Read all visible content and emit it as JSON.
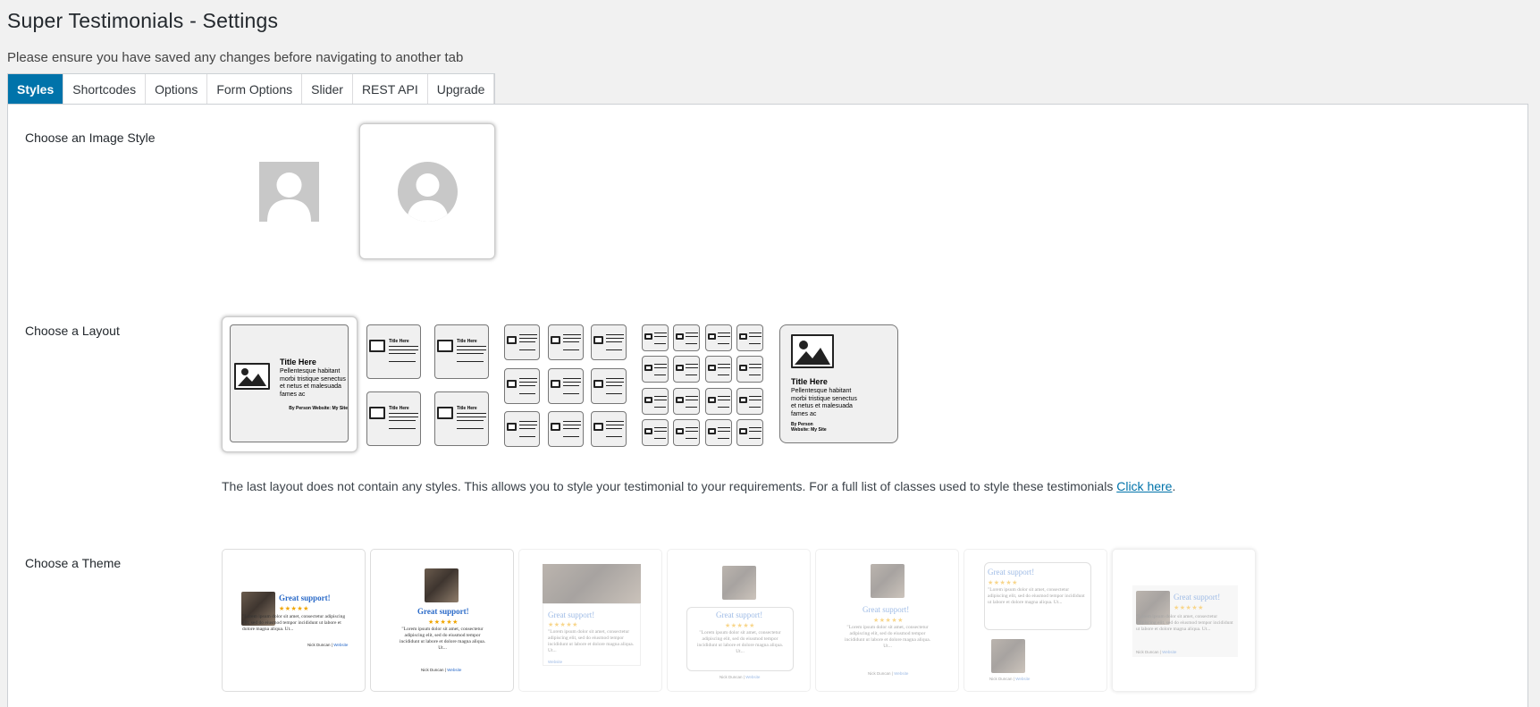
{
  "header": {
    "title": "Super Testimonials - Settings",
    "notice": "Please ensure you have saved any changes before navigating to another tab"
  },
  "tabs": [
    {
      "label": "Styles",
      "active": true
    },
    {
      "label": "Shortcodes",
      "active": false
    },
    {
      "label": "Options",
      "active": false
    },
    {
      "label": "Form Options",
      "active": false
    },
    {
      "label": "Slider",
      "active": false
    },
    {
      "label": "REST API",
      "active": false
    },
    {
      "label": "Upgrade",
      "active": false
    }
  ],
  "image_style": {
    "label": "Choose an Image Style",
    "options": [
      "square-avatar",
      "circle-avatar"
    ],
    "selected": "circle-avatar"
  },
  "layout": {
    "label": "Choose a Layout",
    "selected_index": 0,
    "sample": {
      "title": "Title Here",
      "body": "Pellentesque habitant morbi tristique senectus et netus et malesuada fames ac",
      "footer": "By Person Website: My Site",
      "footer_by": "By Person",
      "footer_website": "Website: My Site"
    },
    "note_text": "The last layout does not contain any styles. This allows you to style your testimonial to your requirements. For a full list of classes used to style these testimonials ",
    "note_link": "Click here",
    "note_end": "."
  },
  "theme": {
    "label": "Choose a Theme",
    "sample": {
      "title": "Great support!",
      "stars": "★★★★★",
      "body": "\"Lorem ipsum dolor sit amet, consectetur adipiscing elit, sed do eiusmod tempor incididunt ut labore et dolore magna aliqua. Ut...",
      "read_more": "Read More\"",
      "author": "Nick Duncan",
      "website": "Website"
    }
  },
  "colors": {
    "accent": "#0073aa",
    "background": "#f1f1f1",
    "panel": "#ffffff"
  }
}
